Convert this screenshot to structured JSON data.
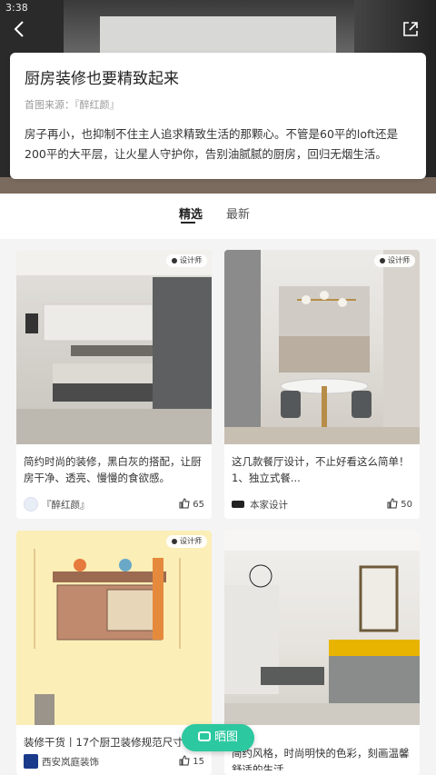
{
  "status": {
    "time": "3:38"
  },
  "article": {
    "title": "厨房装修也要精致起来",
    "source": "首图来源：『醉红颜』",
    "description": "房子再小，也抑制不住主人追求精致生活的那颗心。不管是60平的loft还是200平的大平层，让火星人守护你，告别油腻腻的厨房，回归无烟生活。"
  },
  "tabs": [
    {
      "label": "精选",
      "active": true
    },
    {
      "label": "最新",
      "active": false
    }
  ],
  "cards": [
    {
      "badge": "设计师",
      "text": "简约时尚的装修，黑白灰的搭配，让厨房干净、透亮、慢慢的食欲感。",
      "author": "『醉红颜』",
      "likes": "65"
    },
    {
      "badge": "设计师",
      "text": "这几款餐厅设计，不止好看这么简单！\n1、独立式餐...",
      "author": "本家设计",
      "likes": "50"
    },
    {
      "badge": "设计师",
      "text": "装修干货丨17个厨卫装修规范尺寸",
      "author": "西安岚庭装饰",
      "likes": "15"
    },
    {
      "badge": "",
      "text": "简约风格，时尚明快的色彩，刻画温馨舒适的生活...",
      "author": "",
      "likes": ""
    }
  ],
  "fab": {
    "label": "晒图"
  },
  "colors": {
    "accent": "#2cc8a0"
  }
}
